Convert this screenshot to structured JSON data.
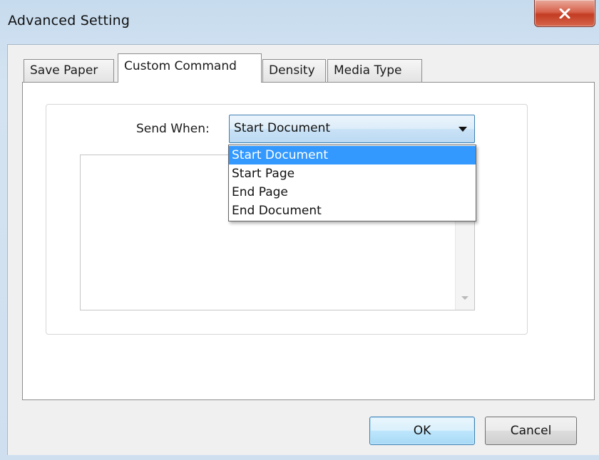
{
  "window": {
    "title": "Advanced Setting",
    "close_label": "X"
  },
  "tabs": [
    {
      "label": "Save Paper",
      "active": false
    },
    {
      "label": "Custom Command",
      "active": true
    },
    {
      "label": "Density",
      "active": false
    },
    {
      "label": "Media Type",
      "active": false
    }
  ],
  "custom_command": {
    "send_when_label": "Send When:",
    "send_when_value": "Start Document",
    "options": [
      "Start Document",
      "Start Page",
      "End Page",
      "End Document"
    ],
    "selected_option": "Start Document",
    "command_text": ""
  },
  "buttons": {
    "ok_label": "OK",
    "cancel_label": "Cancel"
  },
  "colors": {
    "title_gradient_top": "#c6dbee",
    "close_button": "#c23c22",
    "selection_highlight": "#3399ff",
    "combo_border": "#3c7fb1",
    "panel_background": "#f0f0f0"
  },
  "icons": {
    "close": "close-x-icon",
    "combo_arrow": "chevron-down-icon",
    "scroll_down": "scroll-down-arrow-icon"
  }
}
